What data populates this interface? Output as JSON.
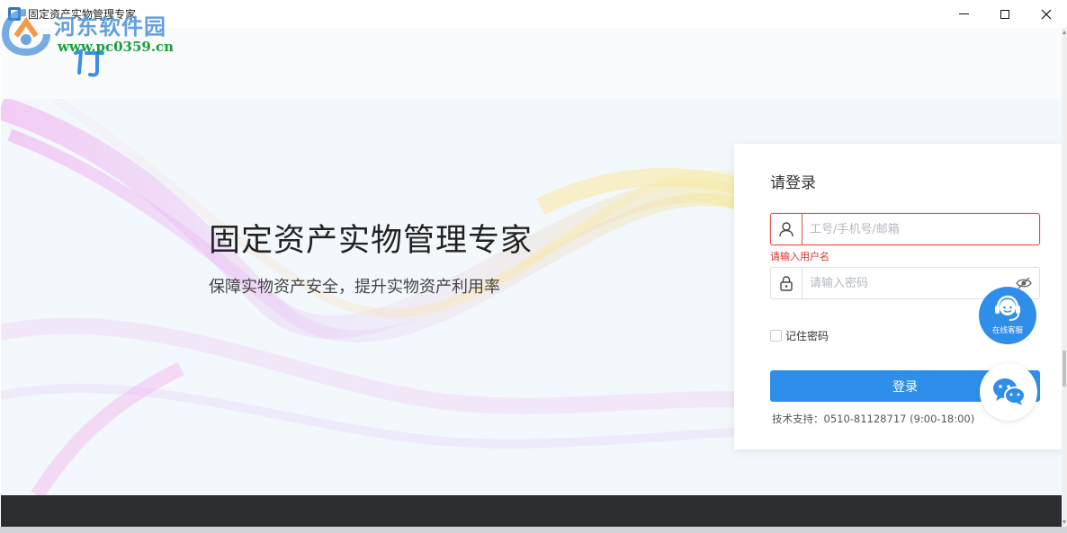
{
  "window": {
    "title": "固定资产实物管理专家",
    "minimize_icon": "minimize-icon",
    "maximize_icon": "maximize-icon",
    "close_icon": "close-icon"
  },
  "watermark": {
    "site_name": "河东软件园",
    "url": "www.pc0359.cn"
  },
  "hero": {
    "title": "固定资产实物管理专家",
    "subtitle": "保障实物资产安全，提升实物资产利用率"
  },
  "login": {
    "heading": "请登录",
    "username_placeholder": "工号/手机号/邮箱",
    "username_value": "",
    "username_error": "请输入用户名",
    "password_placeholder": "请输入密码",
    "password_value": "",
    "remember_label": "记住密码",
    "remember_checked": false,
    "submit_label": "登录",
    "support_text": "技术支持：0510-81128717 (9:00-18:00)"
  },
  "floating": {
    "service_label": "在线客服",
    "wechat_icon": "wechat-icon"
  },
  "colors": {
    "primary": "#2f8eea",
    "error": "#d9302b",
    "footer": "#2c2d30"
  }
}
